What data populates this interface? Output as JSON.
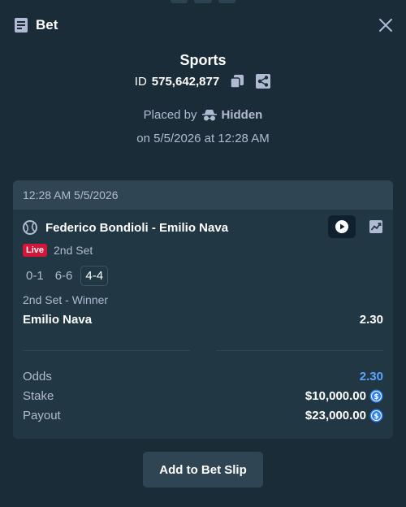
{
  "header": {
    "title": "Bet"
  },
  "summary": {
    "category": "Sports",
    "id_label": "ID",
    "id_value": "575,642,877",
    "placed_by_label": "Placed by",
    "placed_by_user": "Hidden",
    "placed_on": "on 5/5/2026 at 12:28 AM"
  },
  "card": {
    "timestamp": "12:28 AM 5/5/2026",
    "match": "Federico Bondioli - Emilio Nava",
    "live_badge": "Live",
    "set": "2nd Set",
    "scores": [
      "0-1",
      "6-6",
      "4-4"
    ],
    "market": "2nd Set - Winner",
    "selection": "Emilio Nava",
    "selection_odds": "2.30",
    "odds_label": "Odds",
    "odds_value": "2.30",
    "stake_label": "Stake",
    "stake_value": "$10,000.00",
    "payout_label": "Payout",
    "payout_value": "$23,000.00"
  },
  "actions": {
    "add_to_bet_slip": "Add to Bet Slip"
  },
  "colors": {
    "background": "#1a2c38",
    "card": "#213743",
    "accent_blue": "#5aa5ff",
    "live_red": "#d5143a",
    "muted": "#b1bad3"
  },
  "icons": [
    "bet-slip-icon",
    "close-icon",
    "copy-icon",
    "share-icon",
    "incognito-icon",
    "tennis-ball-icon",
    "play-icon",
    "chart-icon",
    "currency-coin-icon"
  ]
}
